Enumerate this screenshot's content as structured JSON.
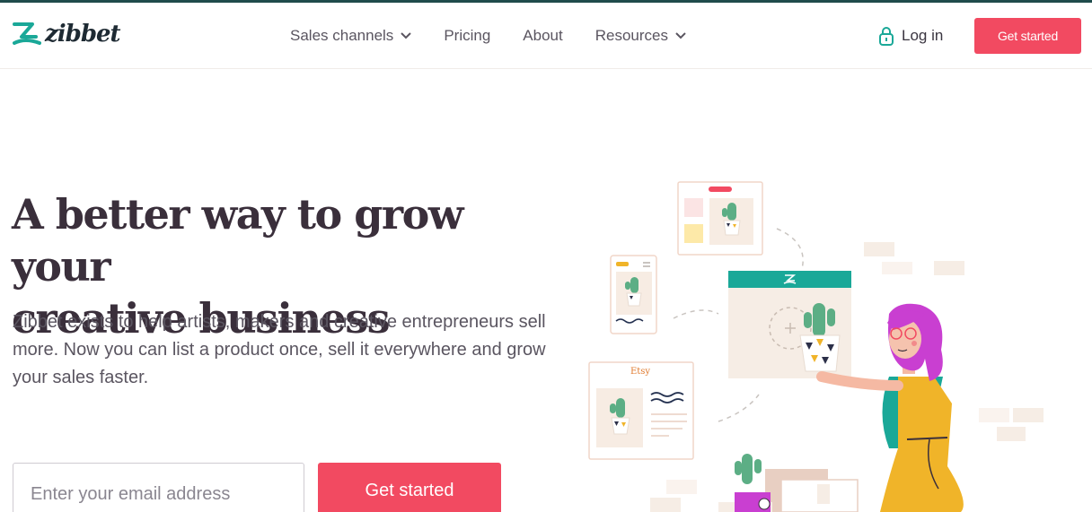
{
  "brand": {
    "name": "zibbet",
    "accent": "#f24a61",
    "teal": "#1aa898"
  },
  "nav": {
    "items": [
      {
        "label": "Sales channels",
        "has_dropdown": true
      },
      {
        "label": "Pricing",
        "has_dropdown": false
      },
      {
        "label": "About",
        "has_dropdown": false
      },
      {
        "label": "Resources",
        "has_dropdown": true
      }
    ],
    "login_label": "Log in",
    "cta_label": "Get started"
  },
  "hero": {
    "headline_line1": "A better way to grow your",
    "headline_line2": "creative business",
    "subtext": "Zibbet exists to help artists, makers and creative entrepreneurs sell more. Now you can list a product once, sell it everywhere and grow your sales faster.",
    "email_placeholder": "Enter your email address",
    "email_value": "",
    "cta_label": "Get started"
  },
  "illustration": {
    "etsy_label": "Etsy"
  }
}
